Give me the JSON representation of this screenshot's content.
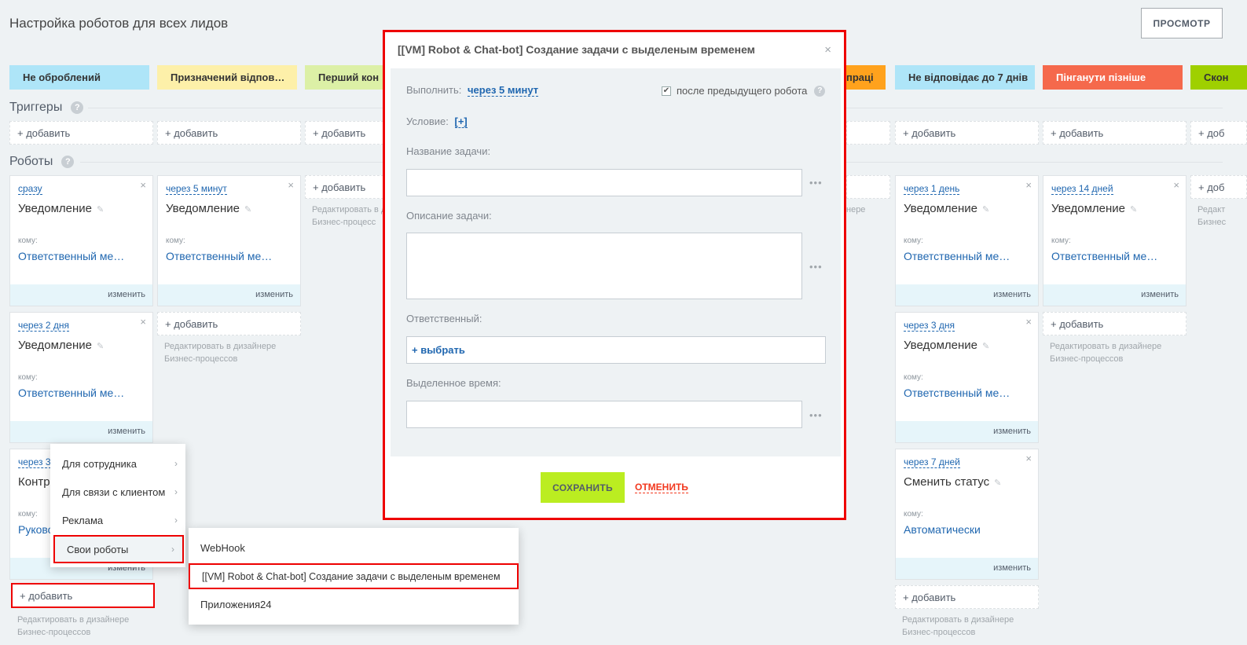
{
  "header": {
    "title": "Настройка роботов для всех лидов",
    "preview_button": "ПРОСМОТР"
  },
  "stages": [
    {
      "label": "Не оброблений",
      "color": "#aee5f8"
    },
    {
      "label": "Призначений відпов…",
      "color": "#fdf0a9"
    },
    {
      "label": "Перший кон",
      "color": "#dcf0a6"
    },
    {
      "label": "праці",
      "color": "#ffa21d"
    },
    {
      "label": "Не відповідає до 7 днів",
      "color": "#aee5f8"
    },
    {
      "label": "Пінганути пізніше",
      "color": "#f5694c"
    },
    {
      "label": "Скон",
      "color": "#9fd000"
    }
  ],
  "triggers": {
    "label": "Триггеры",
    "help": "?",
    "add": "+ добавить"
  },
  "robots_section": {
    "label": "Роботы",
    "help": "?",
    "add": "+ добавить",
    "add_short": "+ доб"
  },
  "common": {
    "close": "×",
    "to_label": "кому:",
    "change": "изменить",
    "hint_line1": "Редактировать в дизайнере",
    "hint_line2": "Бизнес-процессов",
    "hint_line1_cut": "Редактировать в д",
    "hint_line2_cut": "Бизнес-процесс",
    "hint_cut_right": "нере",
    "hint_cut_far": "Редакт",
    "hint_cut_far2": "Бизнес"
  },
  "robots": [
    {
      "delay": "сразу",
      "title": "Уведомление",
      "to": "Ответственный ме…"
    },
    {
      "delay": "через 5 минут",
      "title": "Уведомление",
      "to": "Ответственный ме…"
    },
    {
      "delay": "через 2 дня",
      "title": "Уведомление",
      "to": "Ответственный ме…"
    },
    {
      "delay": "через 3",
      "title": "Контро",
      "to": "Руково"
    },
    {
      "delay": "через 1 день",
      "title": "Уведомление",
      "to": "Ответственный ме…"
    },
    {
      "delay": "через 14 дней",
      "title": "Уведомление",
      "to": "Ответственный ме…"
    },
    {
      "delay": "через 3 дня",
      "title": "Уведомление",
      "to": "Ответственный ме…"
    },
    {
      "delay": "через 7 дней",
      "title": "Сменить статус",
      "to": "Автоматически"
    }
  ],
  "menu": {
    "items": [
      "Для сотрудника",
      "Для связи с клиентом",
      "Реклама",
      "Свои роботы"
    ],
    "submenu": [
      "WebHook",
      "[[VM] Robot & Chat-bot] Создание задачи с выделеным временем",
      "Приложения24"
    ]
  },
  "modal": {
    "title": "[[VM] Robot & Chat-bot] Создание задачи с выделеным временем",
    "execute_label": "Выполнить:",
    "execute_value": "через 5 минут",
    "after_prev": "после предыдущего робота",
    "condition_label": "Условие:",
    "condition_value": "[+]",
    "task_name_label": "Название задачи:",
    "task_desc_label": "Описание задачи:",
    "responsible_label": "Ответственный:",
    "responsible_select": "+ выбрать",
    "time_label": "Выделенное время:",
    "dots": "•••",
    "save": "СОХРАНИТЬ",
    "cancel": "ОТМЕНИТЬ"
  }
}
